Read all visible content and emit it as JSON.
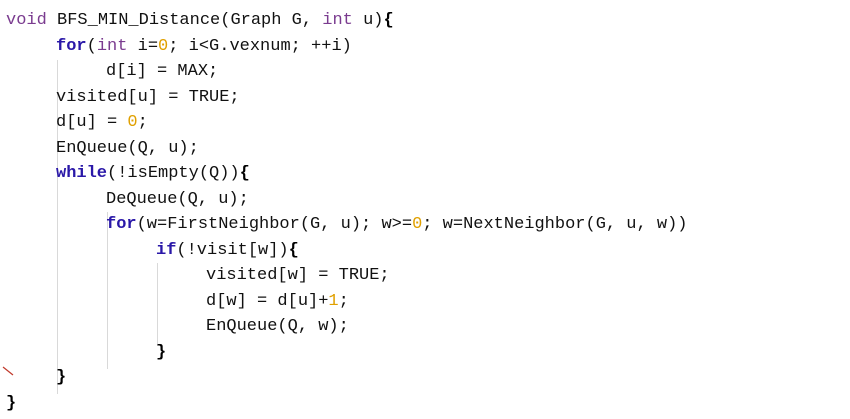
{
  "code": {
    "lines": [
      {
        "indent": 0,
        "tokens": [
          {
            "t": "kw",
            "v": "void"
          },
          {
            "t": "plain",
            "v": " BFS_MIN_Distance(Graph G, "
          },
          {
            "t": "kw",
            "v": "int"
          },
          {
            "t": "plain",
            "v": " u)"
          },
          {
            "t": "brace",
            "v": "{"
          }
        ]
      },
      {
        "indent": 1,
        "tokens": [
          {
            "t": "kwb",
            "v": "for"
          },
          {
            "t": "plain",
            "v": "("
          },
          {
            "t": "kw",
            "v": "int"
          },
          {
            "t": "plain",
            "v": " i="
          },
          {
            "t": "num",
            "v": "0"
          },
          {
            "t": "plain",
            "v": "; i<G.vexnum; ++i)"
          }
        ]
      },
      {
        "indent": 2,
        "tokens": [
          {
            "t": "plain",
            "v": "d[i] = MAX;"
          }
        ]
      },
      {
        "indent": 1,
        "tokens": [
          {
            "t": "plain",
            "v": "visited[u] = TRUE;"
          }
        ]
      },
      {
        "indent": 1,
        "tokens": [
          {
            "t": "plain",
            "v": "d[u] = "
          },
          {
            "t": "num",
            "v": "0"
          },
          {
            "t": "plain",
            "v": ";"
          }
        ]
      },
      {
        "indent": 1,
        "tokens": [
          {
            "t": "plain",
            "v": "EnQueue(Q, u);"
          }
        ]
      },
      {
        "indent": 1,
        "tokens": [
          {
            "t": "kwb",
            "v": "while"
          },
          {
            "t": "plain",
            "v": "(!isEmpty(Q))"
          },
          {
            "t": "brace",
            "v": "{"
          }
        ]
      },
      {
        "indent": 2,
        "tokens": [
          {
            "t": "plain",
            "v": "DeQueue(Q, u);"
          }
        ]
      },
      {
        "indent": 2,
        "tokens": [
          {
            "t": "kwb",
            "v": "for"
          },
          {
            "t": "plain",
            "v": "(w=FirstNeighbor(G, u); w>="
          },
          {
            "t": "num",
            "v": "0"
          },
          {
            "t": "plain",
            "v": "; w=NextNeighbor(G, u, w))"
          }
        ]
      },
      {
        "indent": 3,
        "tokens": [
          {
            "t": "kwb",
            "v": "if"
          },
          {
            "t": "plain",
            "v": "(!visit[w])"
          },
          {
            "t": "brace",
            "v": "{"
          }
        ]
      },
      {
        "indent": 4,
        "tokens": [
          {
            "t": "plain",
            "v": "visited[w] = TRUE;"
          }
        ]
      },
      {
        "indent": 4,
        "tokens": [
          {
            "t": "plain",
            "v": "d[w] = d[u]+"
          },
          {
            "t": "num",
            "v": "1"
          },
          {
            "t": "plain",
            "v": ";"
          }
        ]
      },
      {
        "indent": 4,
        "tokens": [
          {
            "t": "plain",
            "v": "EnQueue(Q, w);"
          }
        ]
      },
      {
        "indent": 3,
        "tokens": [
          {
            "t": "brace",
            "v": "}"
          }
        ]
      },
      {
        "indent": 1,
        "tokens": [
          {
            "t": "brace",
            "v": "}"
          }
        ]
      },
      {
        "indent": 0,
        "tokens": [
          {
            "t": "brace",
            "v": "}"
          }
        ]
      }
    ]
  },
  "colors": {
    "keyword_bold": "#2a18a8",
    "keyword": "#7a3b8f",
    "number": "#e0a000",
    "text": "#111111"
  }
}
